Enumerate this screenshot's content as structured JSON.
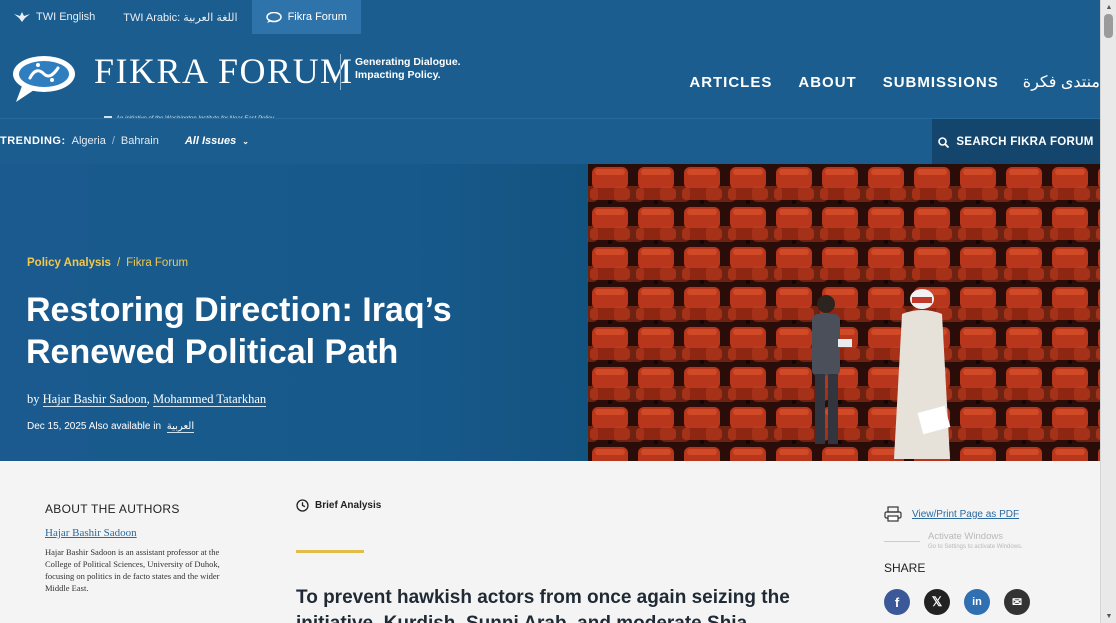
{
  "utility_bar": {
    "items": [
      {
        "label": "TWI English"
      },
      {
        "label": "TWI Arabic: اللغة العربية"
      },
      {
        "label": "Fikra Forum"
      }
    ]
  },
  "header": {
    "brand": "FIKRA FORUM",
    "brand_sub": "An initiative of the Washington Institute for Near East Policy",
    "tagline_line1": "Generating Dialogue.",
    "tagline_line2": "Impacting Policy.",
    "nav": [
      {
        "label": "ARTICLES"
      },
      {
        "label": "ABOUT"
      },
      {
        "label": "SUBMISSIONS"
      },
      {
        "label": "منتدى فكرة"
      }
    ]
  },
  "trending": {
    "label": "TRENDING:",
    "links": [
      "Algeria",
      "Bahrain"
    ],
    "separator": "/",
    "all_issues": "All Issues",
    "search_label": "SEARCH FIKRA FORUM"
  },
  "hero": {
    "category": "Policy Analysis",
    "breadcrumb_sep": "/",
    "subcategory": "Fikra Forum",
    "title": "Restoring Direction: Iraq’s Renewed Political Path",
    "by": "by",
    "author1": "Hajar Bashir Sadoon",
    "author_sep": ",",
    "author2": "Mohammed Tatarkhan",
    "date": "Dec 15, 2025",
    "also_available": "Also available in",
    "arabic_link": "العربية"
  },
  "content": {
    "about_title": "ABOUT THE AUTHORS",
    "author_name": "Hajar Bashir Sadoon",
    "author_bio": "Hajar Bashir Sadoon is an assistant professor at the College of Political Sciences, University of Duhok, focusing on politics in de facto states and the wider Middle East.",
    "article_type": "Brief Analysis",
    "lede": "To prevent hawkish actors from once again seizing the initiative, Kurdish, Sunni Arab, and moderate Shia",
    "pdf_label": "View/Print Page as PDF",
    "activate_title": "Activate Windows",
    "activate_sub": "Go to Settings to activate Windows.",
    "share_title": "SHARE",
    "share_icons": [
      {
        "name": "facebook",
        "glyph": "f",
        "color": "#3b5998"
      },
      {
        "name": "x",
        "glyph": "𝕏",
        "color": "#222222"
      },
      {
        "name": "linkedin",
        "glyph": "in",
        "color": "#2f6fb2"
      },
      {
        "name": "email",
        "glyph": "✉",
        "color": "#333333"
      }
    ]
  },
  "colors": {
    "brand_blue": "#1b5d8f",
    "accent_gold": "#f2c94c",
    "search_bg": "#14466d"
  }
}
